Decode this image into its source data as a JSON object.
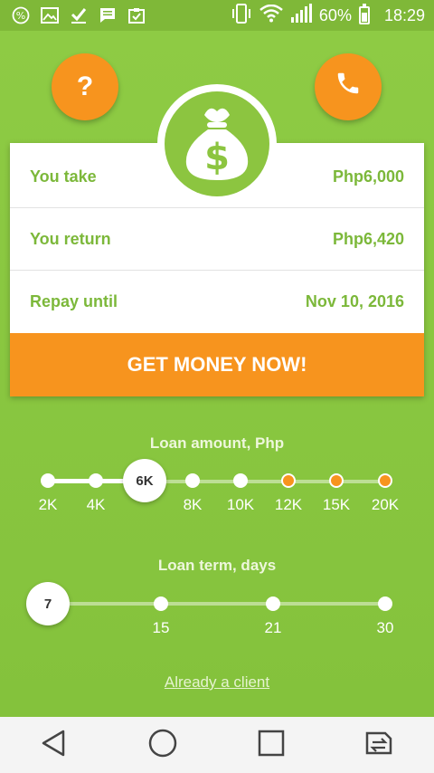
{
  "status_bar": {
    "battery_percent": "60%",
    "time": "18:29",
    "icons": [
      "percent-icon",
      "image-icon",
      "download-check-icon",
      "message-icon",
      "clipboard-check-icon",
      "vibrate-icon",
      "wifi-icon",
      "signal-icon",
      "battery-icon"
    ]
  },
  "top_buttons": {
    "help_label": "?",
    "help_icon": "question-icon",
    "phone_icon": "phone-icon"
  },
  "loan_card": {
    "icon": "money-bag-icon",
    "rows": [
      {
        "label": "You take",
        "value": "Php6,000"
      },
      {
        "label": "You return",
        "value": "Php6,420"
      },
      {
        "label": "Repay until",
        "value": "Nov 10, 2016"
      }
    ],
    "cta_label": "GET MONEY NOW!"
  },
  "amount_slider": {
    "title": "Loan amount, Php",
    "selected": "6K",
    "ticks": [
      "2K",
      "4K",
      "8K",
      "10K",
      "12K",
      "15K",
      "20K"
    ]
  },
  "term_slider": {
    "title": "Loan term, days",
    "selected": "7",
    "ticks": [
      "15",
      "21",
      "30"
    ]
  },
  "client_link": "Already a client",
  "colors": {
    "brand_green": "#8cc540",
    "accent_orange": "#f7941e",
    "text_green": "#7cb83a"
  },
  "nav_bar": {
    "icons": [
      "back-icon",
      "home-icon",
      "recents-icon",
      "switch-sim-icon"
    ]
  }
}
